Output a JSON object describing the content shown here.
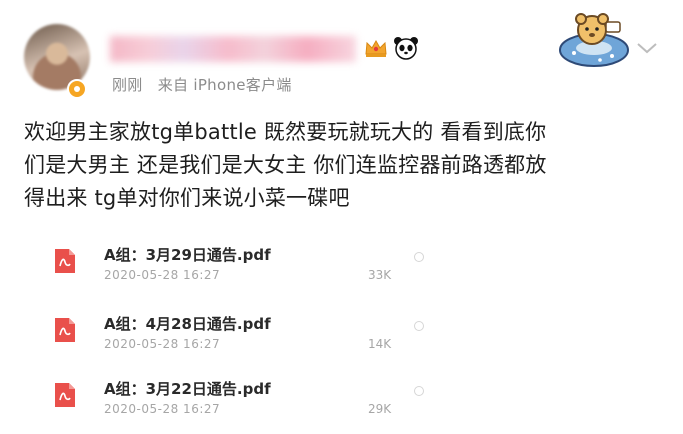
{
  "post": {
    "meta_time": "刚刚",
    "meta_source": "来自 iPhone客户端",
    "text_lines": [
      "欢迎男主家放tg单battle 既然要玩就玩大的 看看到底你",
      "们是大男主 还是我们是大女主 你们连监控器前路透都放",
      "得出来 tg单对你们来说小菜一碟吧"
    ]
  },
  "files": [
    {
      "name": "A组：3月29日通告.pdf",
      "date": "2020-05-28 16:27",
      "size": "33K",
      "icon": "pdf-icon"
    },
    {
      "name": "A组：4月28日通告.pdf",
      "date": "2020-05-28 16:27",
      "size": "14K",
      "icon": "pdf-icon"
    },
    {
      "name": "A组：3月22日通告.pdf",
      "date": "2020-05-28 16:27",
      "size": "29K",
      "icon": "pdf-icon"
    }
  ],
  "icons": {
    "avatar_badge": "verified-badge-icon",
    "name_decoration": [
      "crown-icon",
      "panda-icon"
    ],
    "card_decoration": "bear-in-float-icon",
    "menu": "chevron-down-icon"
  },
  "colors": {
    "pdf_red": "#e9504b",
    "meta_gray": "#8b8b8b",
    "text": "#1e1e1e"
  }
}
